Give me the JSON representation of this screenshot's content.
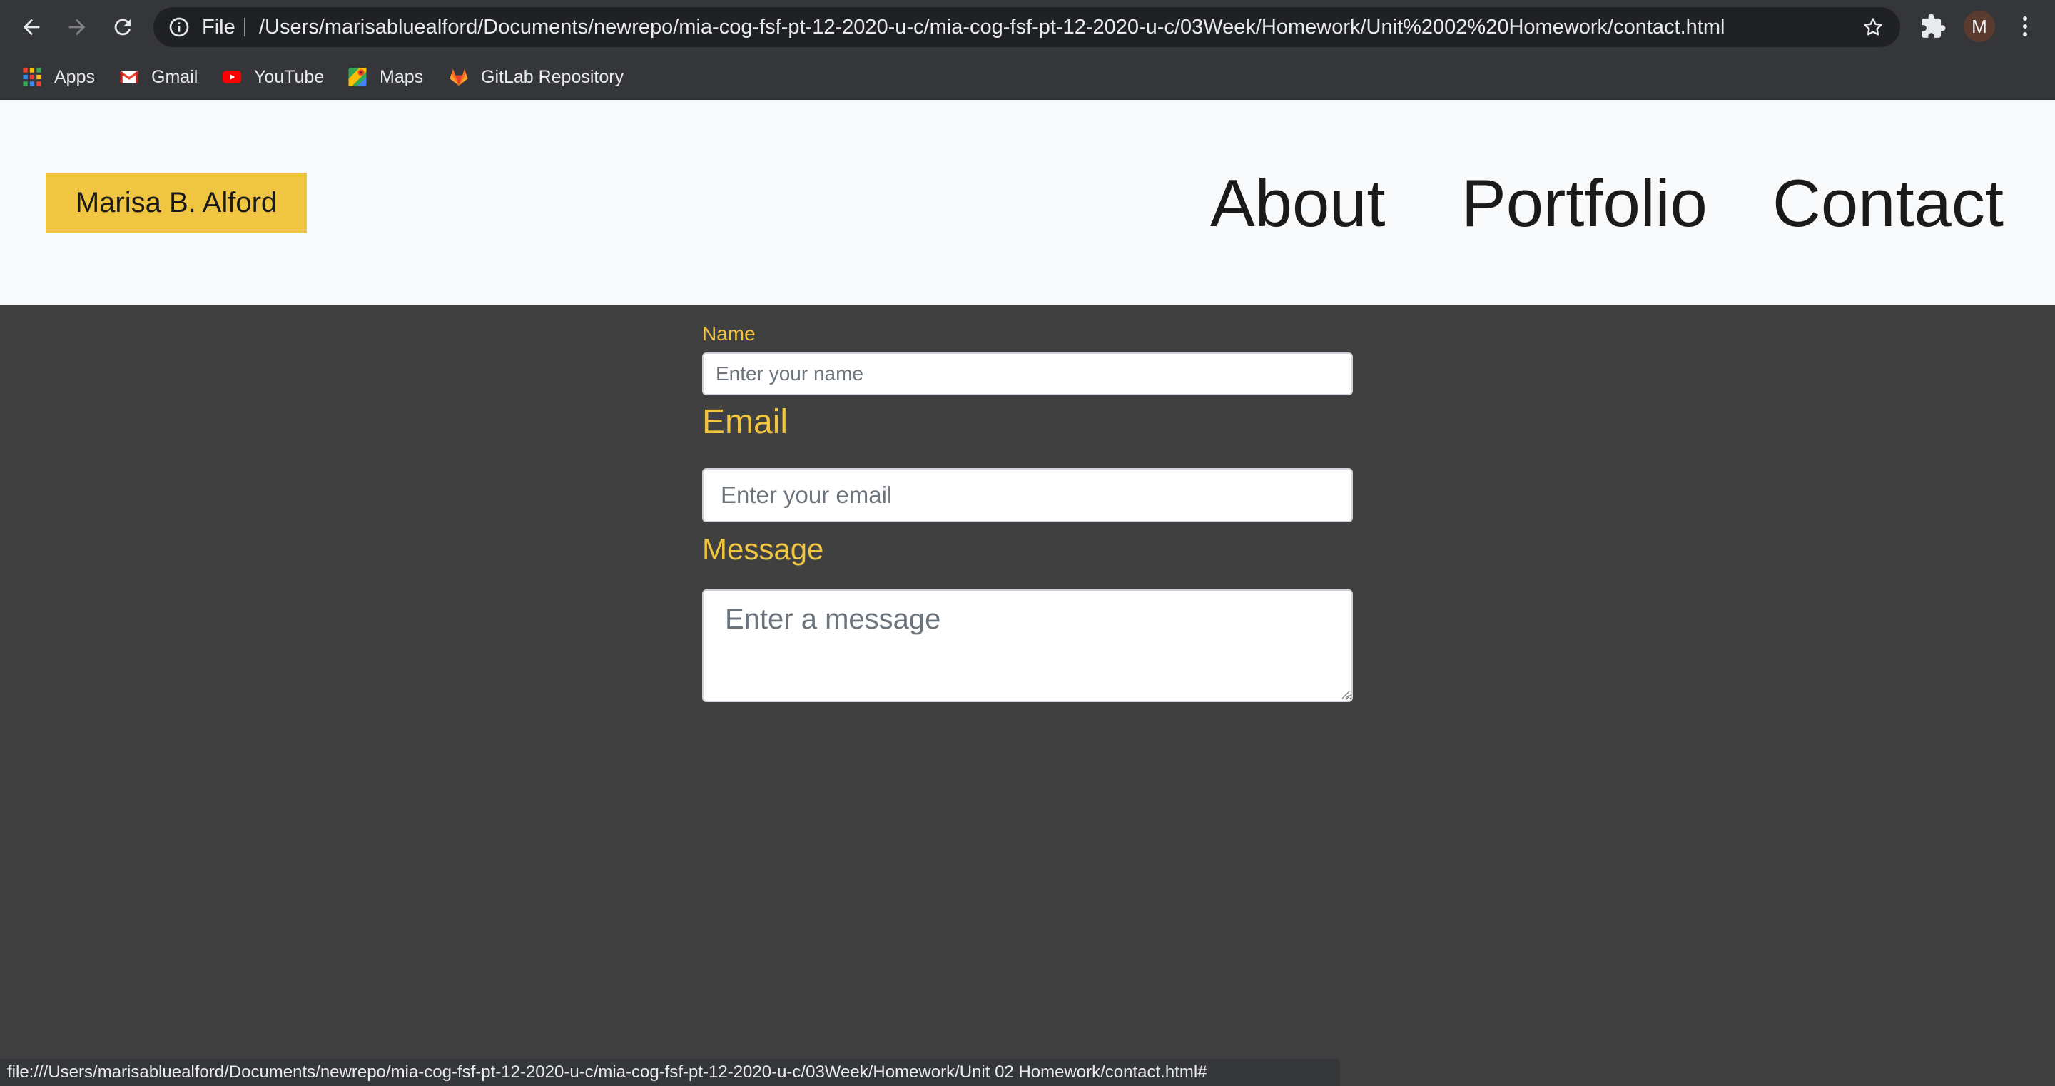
{
  "browser": {
    "omnibox": {
      "scheme_label": "File",
      "url": "/Users/marisabluealford/Documents/newrepo/mia-cog-fsf-pt-12-2020-u-c/mia-cog-fsf-pt-12-2020-u-c/03Week/Homework/Unit%2002%20Homework/contact.html"
    },
    "profile_initial": "M",
    "icons": {
      "back": "arrow-left-icon",
      "forward": "arrow-right-icon",
      "reload": "reload-icon",
      "site_info": "info-icon",
      "bookmark": "star-icon",
      "extensions": "puzzle-icon",
      "menu": "kebab-menu-icon"
    },
    "bookmarks": [
      {
        "label": "Apps",
        "icon": "apps-grid-icon"
      },
      {
        "label": "Gmail",
        "icon": "gmail-icon"
      },
      {
        "label": "YouTube",
        "icon": "youtube-icon"
      },
      {
        "label": "Maps",
        "icon": "maps-icon"
      },
      {
        "label": "GitLab Repository",
        "icon": "gitlab-icon"
      }
    ],
    "status_url": "file:///Users/marisabluealford/Documents/newrepo/mia-cog-fsf-pt-12-2020-u-c/mia-cog-fsf-pt-12-2020-u-c/03Week/Homework/Unit 02 Homework/contact.html#"
  },
  "site": {
    "brand": "Marisa B. Alford",
    "nav": [
      "About",
      "Portfolio",
      "Contact"
    ]
  },
  "form": {
    "name": {
      "label": "Name",
      "placeholder": "Enter your name"
    },
    "email": {
      "label": "Email",
      "placeholder": "Enter your email"
    },
    "message": {
      "label": "Message",
      "placeholder": "Enter a message"
    }
  },
  "colors": {
    "accent": "#f0c541",
    "page_background": "#404040",
    "header_background": "#f8f9fa",
    "browser_chrome": "#35363a"
  }
}
